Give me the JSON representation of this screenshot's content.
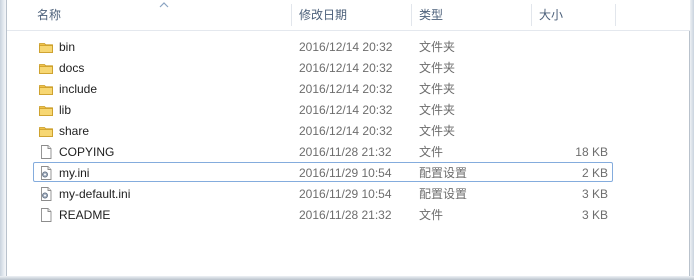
{
  "columns": {
    "name": "名称",
    "date": "修改日期",
    "type": "类型",
    "size": "大小"
  },
  "colors": {
    "folder": "#f0c24a",
    "selection_border": "#84acdd",
    "header_text": "#4c607a",
    "secondary_text": "#6d6d6d"
  },
  "files": [
    {
      "name": "bin",
      "date": "2016/12/14 20:32",
      "type": "文件夹",
      "size": "",
      "icon": "folder-icon"
    },
    {
      "name": "docs",
      "date": "2016/12/14 20:32",
      "type": "文件夹",
      "size": "",
      "icon": "folder-icon"
    },
    {
      "name": "include",
      "date": "2016/12/14 20:32",
      "type": "文件夹",
      "size": "",
      "icon": "folder-icon"
    },
    {
      "name": "lib",
      "date": "2016/12/14 20:32",
      "type": "文件夹",
      "size": "",
      "icon": "folder-icon"
    },
    {
      "name": "share",
      "date": "2016/12/14 20:32",
      "type": "文件夹",
      "size": "",
      "icon": "folder-icon"
    },
    {
      "name": "COPYING",
      "date": "2016/11/28 21:32",
      "type": "文件",
      "size": "18 KB",
      "icon": "file-icon"
    },
    {
      "name": "my.ini",
      "date": "2016/11/29 10:54",
      "type": "配置设置",
      "size": "2 KB",
      "icon": "settings-file-icon",
      "selected": true
    },
    {
      "name": "my-default.ini",
      "date": "2016/11/29 10:54",
      "type": "配置设置",
      "size": "3 KB",
      "icon": "settings-file-icon"
    },
    {
      "name": "README",
      "date": "2016/11/28 21:32",
      "type": "文件",
      "size": "3 KB",
      "icon": "file-icon"
    }
  ]
}
